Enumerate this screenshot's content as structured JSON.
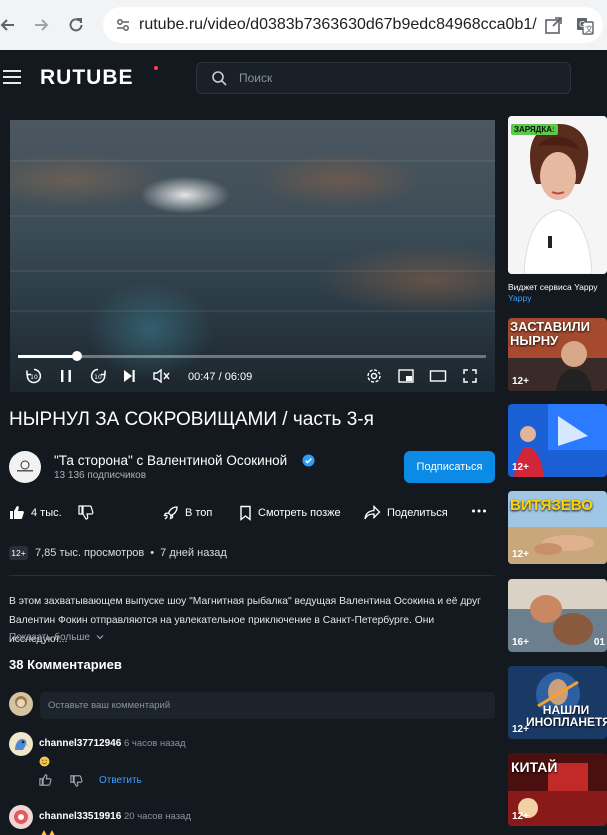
{
  "browser": {
    "url": "rutube.ru/video/d0383b7363630d67b9edc84968cca0b1/"
  },
  "header": {
    "logo": "RUTUBE",
    "search_placeholder": "Поиск"
  },
  "player": {
    "time": "00:47 / 06:09",
    "progress": 0.127,
    "rewind_label": "10",
    "forward_label": "10"
  },
  "video": {
    "title": "НЫРНУЛ ЗА СОКРОВИЩАМИ / часть 3-я",
    "channel_name": "\"Та сторона\" с Валентиной Осокиной",
    "subscribers": "13 136 подписчиков",
    "subscribe_label": "Подписаться",
    "likes": "4 тыс.",
    "to_top": "В топ",
    "watch_later": "Смотреть позже",
    "share": "Поделиться",
    "age": "12+",
    "views": "7,85 тыс. просмотров",
    "dot": "•",
    "posted": "7 дней назад",
    "description_line1": "В этом захватывающем выпуске шоу \"Магнитная рыбалка\" ведущая Валентина Осокина и её друг",
    "description_line2": "Валентин Фокин отправляются на увлекательное приключение в Санкт-Петербурге. Они исследуют...",
    "show_more": "Показать больше"
  },
  "comments": {
    "title": "38 Комментариев",
    "input_placeholder": "Оставьте ваш комментарий",
    "items": [
      {
        "author": "channel37712946",
        "time": "6 часов назад",
        "reply": "Ответить"
      },
      {
        "author": "channel33519916",
        "time": "20 часов назад"
      }
    ]
  },
  "sidebar": {
    "items": [
      {
        "overlay": "ЗАРЯДКА:",
        "caption": "Виджет сервиса Yappy",
        "source": "Yappy"
      },
      {
        "overlay": "ЗАСТАВИЛИ НЫРНУ",
        "age": "12+"
      },
      {
        "age": "12+"
      },
      {
        "overlay": "ВИТЯЗЕВО",
        "age": "12+"
      },
      {
        "age": "16+",
        "timestamp": "01"
      },
      {
        "overlay": "НАШЛИ ИНОПЛАНЕТЯНИНА",
        "age": "12+"
      },
      {
        "overlay": "КИТАЙ",
        "age": "12+"
      }
    ]
  },
  "colors": {
    "accent": "#0b8ae6",
    "background": "#14191f",
    "link": "#3d9fff"
  }
}
